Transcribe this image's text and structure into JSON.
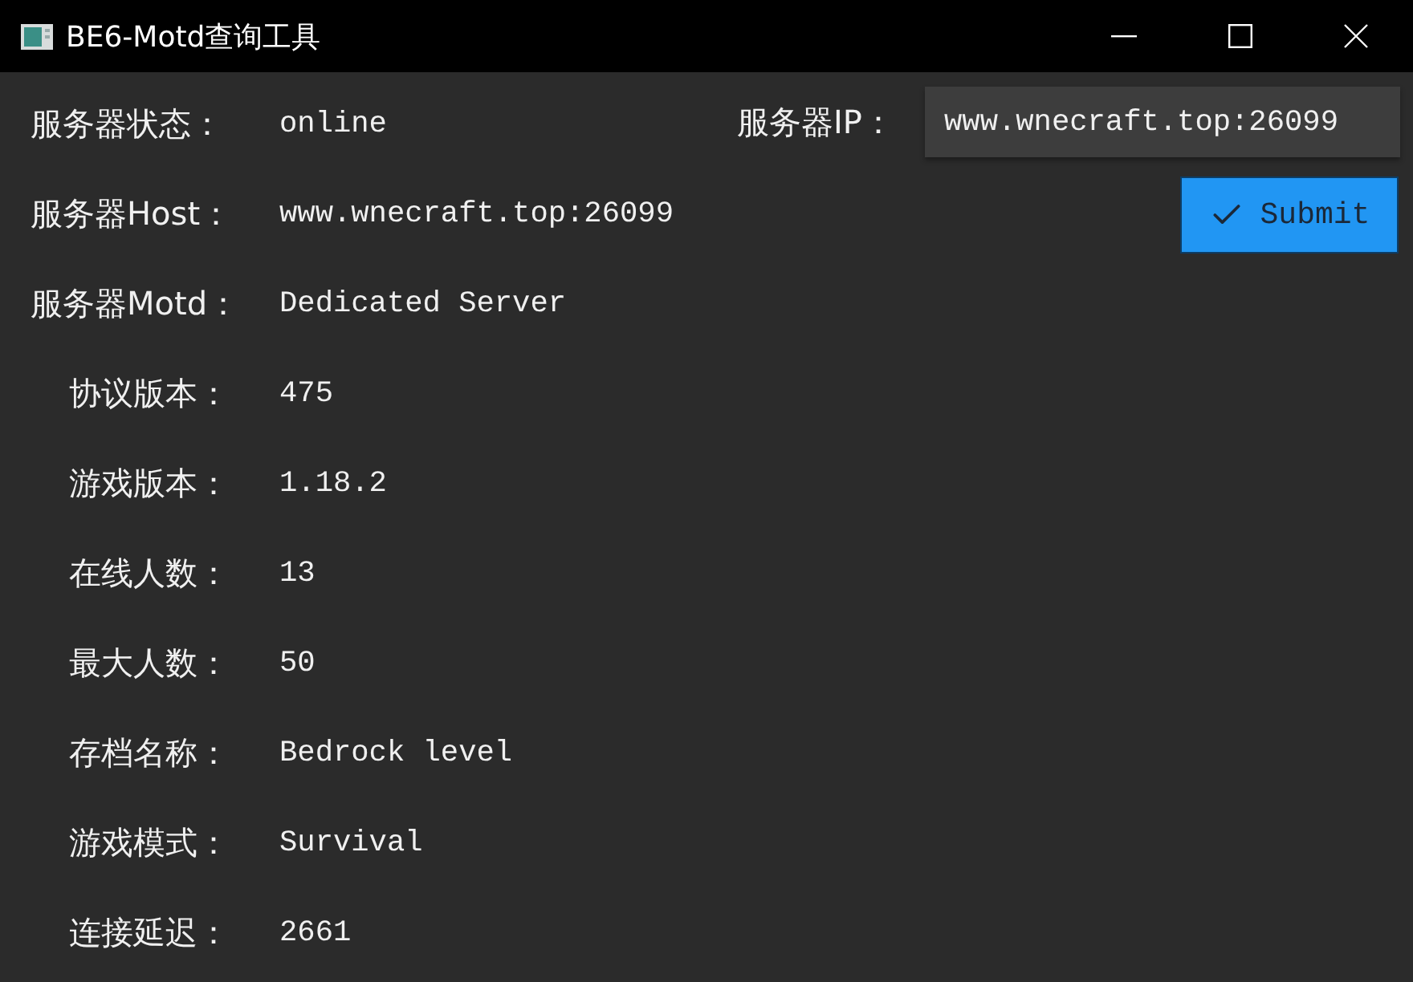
{
  "window": {
    "title": "BE6-Motd查询工具"
  },
  "fields": [
    {
      "label": "服务器状态：",
      "value": "online"
    },
    {
      "label": "服务器Host：",
      "value": "www.wnecraft.top:26099"
    },
    {
      "label": "服务器Motd：",
      "value": "Dedicated Server",
      "children": [
        {
          "label": "协议版本：",
          "value": "475"
        },
        {
          "label": "游戏版本：",
          "value": "1.18.2"
        },
        {
          "label": "在线人数：",
          "value": "13"
        },
        {
          "label": "最大人数：",
          "value": "50"
        },
        {
          "label": "存档名称：",
          "value": "Bedrock level"
        },
        {
          "label": "游戏模式：",
          "value": "Survival"
        },
        {
          "label": "连接延迟：",
          "value": "2661"
        }
      ]
    }
  ],
  "ip_field": {
    "label": "服务器IP：",
    "value": "www.wnecraft.top:26099"
  },
  "submit_button": {
    "label": "Submit"
  }
}
